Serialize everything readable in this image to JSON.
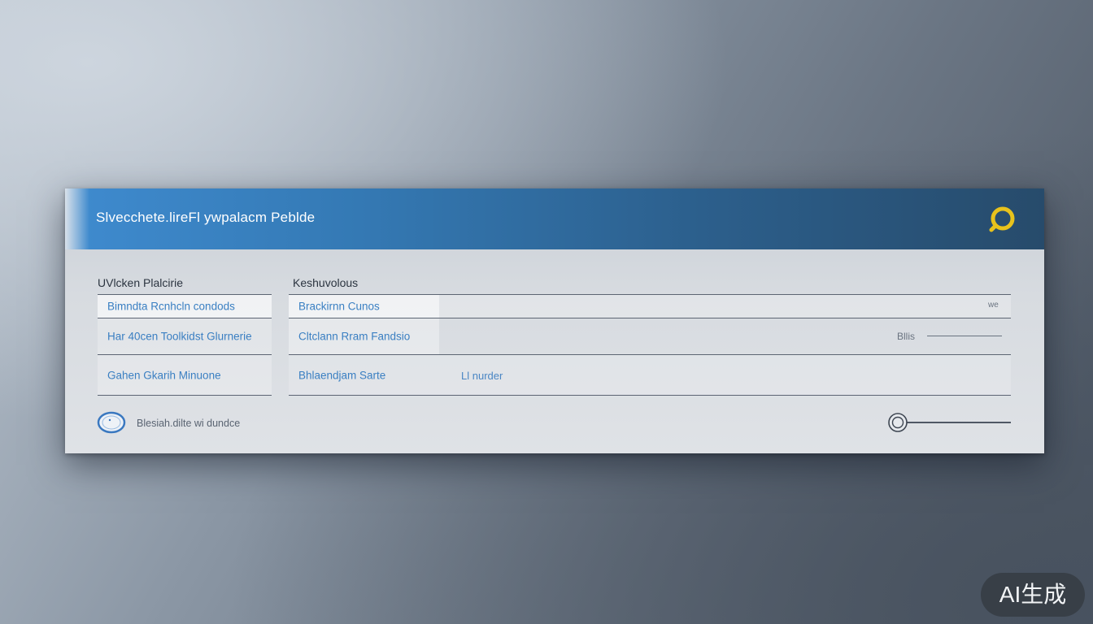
{
  "window": {
    "title": "Slvecchete.lireFl ywpalacm Peblde"
  },
  "columns": {
    "left_label": "UVlcken Plalcirie",
    "right_label": "Keshuvolous"
  },
  "left_rows": [
    {
      "text": "Bimndta Rcnhcln condods"
    },
    {
      "text": "Har 40cen Toolkidst Glurnerie"
    },
    {
      "text": "Gahen Gkarih Minuone"
    }
  ],
  "right_rows": [
    {
      "text": "Brackirnn Cunos",
      "meta": "we"
    },
    {
      "text": "Cltclann Rram Fandsio",
      "meta": "Bllis"
    },
    {
      "text": "Bhlaendjam Sarte",
      "meta": "Ll nurder"
    }
  ],
  "status": {
    "text": "Blesiah.dilte wi dundce"
  },
  "slider": {
    "value": 0.0
  },
  "badge": {
    "text": "AI生成"
  },
  "colors": {
    "accent": "#3f8bcf",
    "link_text": "#3a7fc2",
    "search_icon": "#e8c21c"
  },
  "icons": {
    "search": "search-icon",
    "status": "globe-icon"
  }
}
